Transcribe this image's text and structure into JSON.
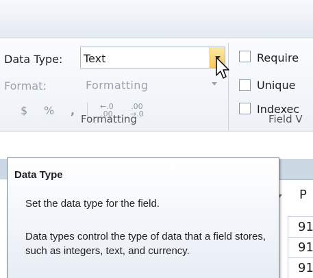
{
  "ribbon": {
    "data_type_label": "Data Type:",
    "data_type_value": "Text",
    "format_label": "Format:",
    "format_value": "Formatting",
    "currency_symbol": "$",
    "percent_symbol": "%",
    "comma_symbol": ",",
    "increase_decimals_top": "←.0",
    "increase_decimals_bottom": ".00",
    "decrease_decimals_top": ".00",
    "decrease_decimals_bottom": "→.0",
    "formatting_group_label": "Formatting",
    "field_validation_label": "Field V",
    "required_label": "Require",
    "unique_label": "Unique",
    "indexed_label": "Indexec"
  },
  "grid": {
    "column_header_letter": "P",
    "cells": [
      "91",
      "91",
      "91"
    ]
  },
  "tooltip": {
    "title": "Data Type",
    "line1": "Set the data type for the field.",
    "line2": "Data types control the type of data that a field stores, such as integers, text, and currency."
  },
  "colors": {
    "dropdown_accent": "#f7c85d",
    "ribbon_bg": "#edf1f6",
    "grid_band": "#cdd8e5"
  }
}
